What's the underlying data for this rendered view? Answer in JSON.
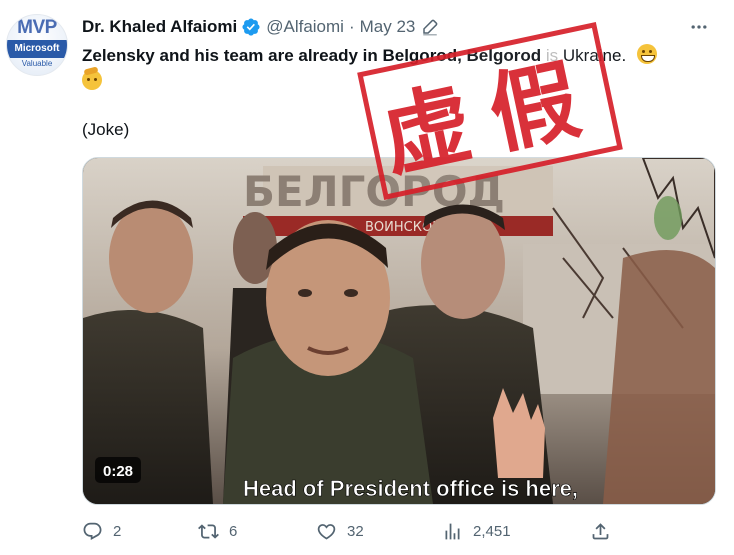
{
  "author": {
    "name": "Dr. Khaled Alfaiomi",
    "handle": "@Alfaiomi",
    "separator": "·",
    "date": "May 23",
    "avatar_text": "MVP",
    "avatar_subtext": "Microsoft",
    "avatar_subtext2": "Valuable"
  },
  "tweet": {
    "line1": "Zelensky and his team are already in Belgorod, Belgorod",
    "line1_hidden": "is",
    "line1_end": "Ukraine.",
    "aside": "(Joke)"
  },
  "media": {
    "sign_text": "БЕЛГОРОД",
    "sign_subtext": "ВОИНСКОЙ",
    "caption": "Head of President office is here,",
    "duration": "0:28",
    "stamp_text": "虚假"
  },
  "actions": {
    "replies": "2",
    "reposts": "6",
    "likes": "32",
    "views": "2,451"
  },
  "icons": {
    "verified": "verified-badge-icon",
    "edit": "edit-pencil-icon",
    "more": "more-dots-icon",
    "reply": "reply-icon",
    "repost": "repost-icon",
    "like": "heart-icon",
    "views": "views-chart-icon",
    "share": "share-icon"
  },
  "colors": {
    "verified_blue": "#1d9bf0",
    "stamp_red": "#d6202a",
    "secondary_text": "#536471"
  }
}
